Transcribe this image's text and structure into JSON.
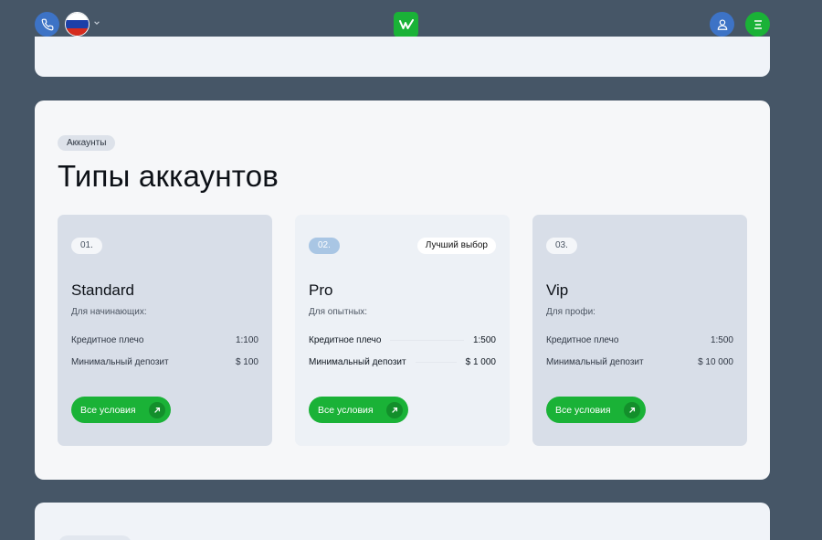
{
  "header": {
    "phone_icon": "phone-icon",
    "language_flag": "russia-flag-icon",
    "logo_icon": "brand-logo-icon",
    "user_icon": "user-icon",
    "menu_icon": "menu-icon"
  },
  "section": {
    "badge": "Аккаунты",
    "title": "Типы аккаунтов"
  },
  "accounts": [
    {
      "num": "01.",
      "name": "Standard",
      "subtitle": "Для начинающих:",
      "rows": [
        {
          "label": "Кредитное плечо",
          "value": "1:100"
        },
        {
          "label": "Минимальный депозит",
          "value": "$ 100"
        }
      ],
      "button": "Все условия"
    },
    {
      "num": "02.",
      "badge": "Лучший выбор",
      "name": "Pro",
      "subtitle": "Для опытных:",
      "rows": [
        {
          "label": "Кредитное плечо",
          "value": "1:500"
        },
        {
          "label": "Минимальный депозит",
          "value": "$ 1 000"
        }
      ],
      "button": "Все условия"
    },
    {
      "num": "03.",
      "name": "Vip",
      "subtitle": "Для профи:",
      "rows": [
        {
          "label": "Кредитное плечо",
          "value": "1:500"
        },
        {
          "label": "Минимальный депозит",
          "value": "$ 10 000"
        }
      ],
      "button": "Все условия"
    }
  ],
  "colors": {
    "background": "#465667",
    "accent_green": "#1ab237",
    "accent_blue": "#3d73c6"
  }
}
